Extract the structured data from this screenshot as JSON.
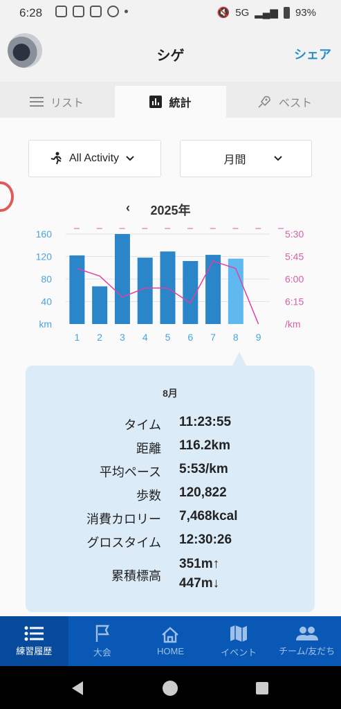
{
  "status": {
    "time": "6:28",
    "network": "5G",
    "battery": "93%"
  },
  "header": {
    "title": "シゲ",
    "share": "シェア"
  },
  "tabs": [
    {
      "label": "リスト",
      "icon": "list-icon"
    },
    {
      "label": "統計",
      "icon": "bar-chart-icon"
    },
    {
      "label": "ベスト",
      "icon": "rocket-icon"
    }
  ],
  "filters": {
    "activity": "All Activity",
    "period": "月間"
  },
  "year_label": "2025年",
  "chart_data": {
    "type": "bar",
    "categories": [
      "1",
      "2",
      "3",
      "4",
      "5",
      "6",
      "7",
      "8",
      "9"
    ],
    "series": [
      {
        "values": [
          122,
          67,
          160,
          118,
          129,
          112,
          123,
          116.2,
          0
        ]
      },
      {
        "values": [
          "5:53",
          "5:58",
          "6:12",
          "6:06",
          "6:06",
          "6:16",
          "5:48",
          "5:53",
          null
        ]
      }
    ],
    "left_axis": {
      "ticks": [
        "160",
        "120",
        "80",
        "40",
        "km"
      ],
      "ylim": [
        0,
        160
      ]
    },
    "right_axis": {
      "ticks": [
        "5:30",
        "5:45",
        "6:00",
        "6:15",
        "/km"
      ],
      "ylim": [
        "6:30",
        "5:30"
      ]
    },
    "highlight_category": "8",
    "colors": {
      "bar": "#2b86c9",
      "bar_selected": "#5fb8f0",
      "pace_line": "#e040a0",
      "axis_left": "#4aa3df",
      "axis_right": "#d65fa8"
    }
  },
  "detail": {
    "month": "8月",
    "rows": [
      {
        "label": "タイム",
        "value": "11:23:55"
      },
      {
        "label": "距離",
        "value": "116.2km"
      },
      {
        "label": "平均ペース",
        "value": "5:53/km"
      },
      {
        "label": "歩数",
        "value": "120,822"
      },
      {
        "label": "消費カロリー",
        "value": "7,468kcal"
      },
      {
        "label": "グロスタイム",
        "value": "12:30:26"
      }
    ],
    "elevation": {
      "label": "累積標高",
      "up": "351m↑",
      "down": "447m↓"
    }
  },
  "bottom_nav": [
    {
      "label": "練習履歴",
      "icon": "list-icon"
    },
    {
      "label": "大会",
      "icon": "flag-icon"
    },
    {
      "label": "HOME",
      "icon": "home-icon"
    },
    {
      "label": "イベント",
      "icon": "map-icon"
    },
    {
      "label": "チーム/友だち",
      "icon": "people-icon"
    }
  ]
}
